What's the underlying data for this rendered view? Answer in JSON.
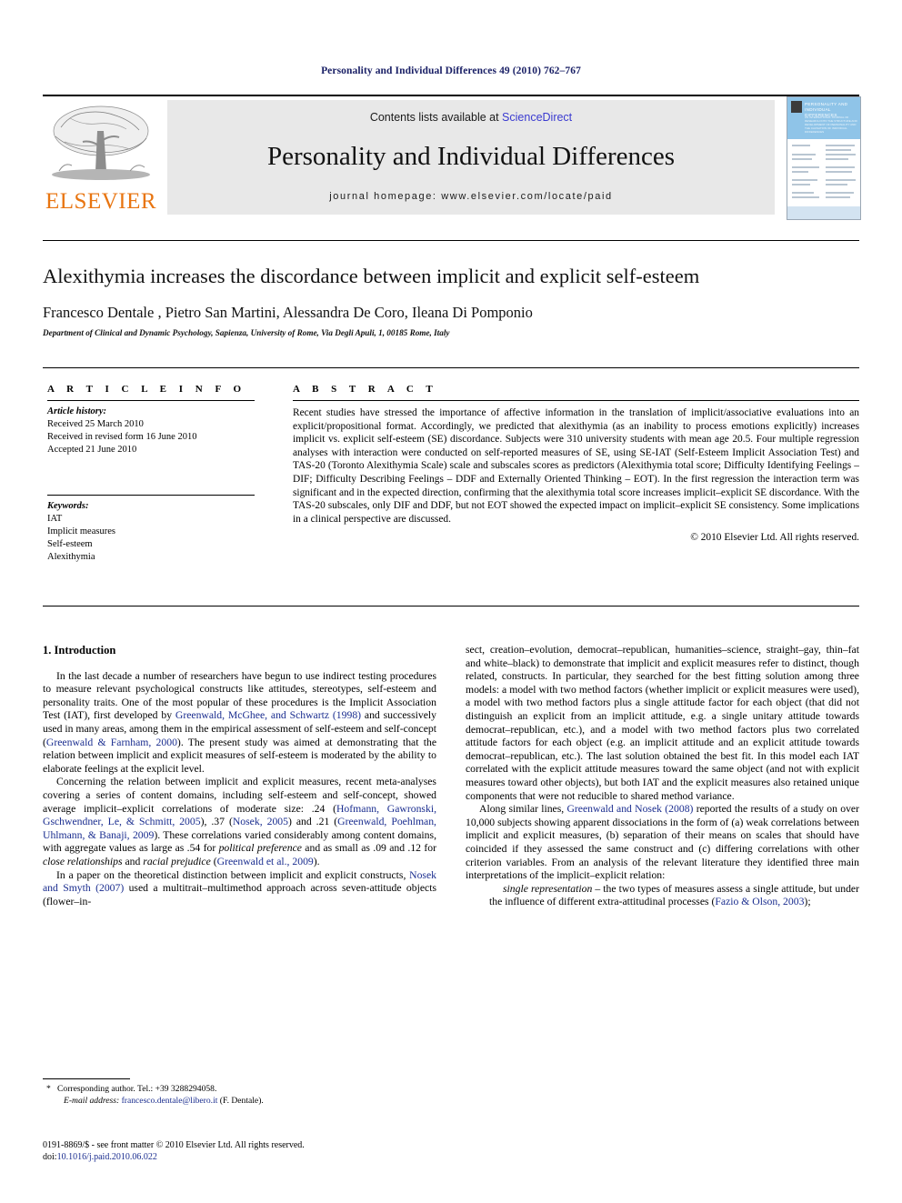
{
  "running_head": "Personality and Individual Differences 49 (2010) 762–767",
  "masthead": {
    "publisher": "ELSEVIER",
    "contents_prefix": "Contents lists available at ",
    "contents_link": "ScienceDirect",
    "journal_title": "Personality and Individual Differences",
    "homepage": "journal homepage: www.elsevier.com/locate/paid",
    "cover": {
      "title_line": "PERSONALITY AND INDIVIDUAL DIFFERENCES",
      "subtitle_line": "AN INTERNATIONAL JOURNAL OF RESEARCH INTO THE STRUCTURE AND DEVELOPMENT OF PERSONALITY AND THE CAUSATION OF INDIVIDUAL DIFFERENCES"
    }
  },
  "article": {
    "title": "Alexithymia increases the discordance between implicit and explicit self-esteem",
    "authors": "Francesco Dentale , Pietro San Martini, Alessandra De Coro, Ileana Di Pomponio",
    "author_marker": "*",
    "affiliation": "Department of Clinical and Dynamic Psychology, Sapienza, University of Rome, Via Degli Apuli, 1, 00185 Rome, Italy"
  },
  "info": {
    "heading": "A R T I C L E   I N F O",
    "history_label": "Article history:",
    "history": [
      "Received 25 March 2010",
      "Received in revised form 16 June 2010",
      "Accepted 21 June 2010"
    ],
    "keywords_label": "Keywords:",
    "keywords": [
      "IAT",
      "Implicit measures",
      "Self-esteem",
      "Alexithymia"
    ]
  },
  "abstract": {
    "heading": "A B S T R A C T",
    "text": "Recent studies have stressed the importance of affective information in the translation of implicit/associative evaluations into an explicit/propositional format. Accordingly, we predicted that alexithymia (as an inability to process emotions explicitly) increases implicit vs. explicit self-esteem (SE) discordance. Subjects were 310 university students with mean age 20.5. Four multiple regression analyses with interaction were conducted on self-reported measures of SE, using SE-IAT (Self-Esteem Implicit Association Test) and TAS-20 (Toronto Alexithymia Scale) scale and subscales scores as predictors (Alexithymia total score; Difficulty Identifying Feelings – DIF; Difficulty Describing Feelings – DDF and Externally Oriented Thinking – EOT). In the first regression the interaction term was significant and in the expected direction, confirming that the alexithymia total score increases implicit–explicit SE discordance. With the TAS-20 subscales, only DIF and DDF, but not EOT showed the expected impact on implicit–explicit SE consistency. Some implications in a clinical perspective are discussed.",
    "copyright": "© 2010 Elsevier Ltd. All rights reserved."
  },
  "body": {
    "section_title": "1. Introduction",
    "left": {
      "p1_a": "In the last decade a number of researchers have begun to use indirect testing procedures to measure relevant psychological constructs like attitudes, stereotypes, self-esteem and personality traits. One of the most popular of these procedures is the Implicit Association Test (IAT), first developed by ",
      "p1_ref1": "Greenwald, McGhee, and Schwartz (1998)",
      "p1_b": " and successively used in many areas, among them in the empirical assessment of self-esteem and self-concept (",
      "p1_ref2": "Greenwald & Farnham, 2000",
      "p1_c": "). The present study was aimed at demonstrating that the relation between implicit and explicit measures of self-esteem is moderated by the ability to elaborate feelings at the explicit level.",
      "p2_a": "Concerning the relation between implicit and explicit measures, recent meta-analyses covering a series of content domains, including self-esteem and self-concept, showed average implicit–explicit correlations of moderate size: .24 (",
      "p2_ref1": "Hofmann, Gawronski, Gschwendner, Le, & Schmitt, 2005",
      "p2_b": "), .37 (",
      "p2_ref2": "Nosek, 2005",
      "p2_c": ") and .21 (",
      "p2_ref3": "Greenwald, Poehlman, Uhlmann, & Banaji, 2009",
      "p2_d": "). These correlations varied considerably among content domains, with aggregate values as large as .54 for ",
      "p2_em1": "political preference",
      "p2_e": " and as small as .09 and .12 for ",
      "p2_em2": "close relationships",
      "p2_f": " and ",
      "p2_em3": "racial prejudice",
      "p2_g": " (",
      "p2_ref4": "Greenwald et al., 2009",
      "p2_h": ").",
      "p3_a": "In a paper on the theoretical distinction between implicit and explicit constructs, ",
      "p3_ref1": "Nosek and Smyth (2007)",
      "p3_b": " used a multitrait–multimethod approach across seven-attitude objects (flower–in-"
    },
    "right": {
      "p1": "sect, creation–evolution, democrat–republican, humanities–science, straight–gay, thin–fat and white–black) to demonstrate that implicit and explicit measures refer to distinct, though related, constructs. In particular, they searched for the best fitting solution among three models: a model with two method factors (whether implicit or explicit measures were used), a model with two method factors plus a single attitude factor for each object (that did not distinguish an explicit from an implicit attitude, e.g. a single unitary attitude towards democrat–republican, etc.), and a model with two method factors plus two correlated attitude factors for each object (e.g. an implicit attitude and an explicit attitude towards democrat–republican, etc.). The last solution obtained the best fit. In this model each IAT correlated with the explicit attitude measures toward the same object (and not with explicit measures toward other objects), but both IAT and the explicit measures also retained unique components that were not reducible to shared method variance.",
      "p2_a": "Along similar lines, ",
      "p2_ref1": "Greenwald and Nosek (2008)",
      "p2_b": " reported the results of a study on over 10,000 subjects showing apparent dissociations in the form of (a) weak correlations between implicit and explicit measures, (b) separation of their means on scales that should have coincided if they assessed the same construct and (c) differing correlations with other criterion variables. From an analysis of the relevant literature they identified three main interpretations of the implicit–explicit relation:",
      "quote_em": "single representation",
      "quote_a": " – the two types of measures assess a single attitude, but under the influence of different extra-attitudinal processes (",
      "quote_ref": "Fazio & Olson, 2003",
      "quote_b": ");"
    }
  },
  "footnote": {
    "star": "*",
    "corresponding": "Corresponding author. Tel.: +39 3288294058.",
    "email_label": "E-mail address:",
    "email": "francesco.dentale@libero.it",
    "email_suffix": " (F. Dentale)."
  },
  "imprint": {
    "line1": "0191-8869/$ - see front matter © 2010 Elsevier Ltd. All rights reserved.",
    "doi_label": "doi:",
    "doi": "10.1016/j.paid.2010.06.022"
  },
  "colors": {
    "accent_link": "#1a2d8f",
    "elsevier_orange": "#e87511",
    "header_blue": "#1a2066",
    "cover_blue": "#8fc4e8"
  }
}
